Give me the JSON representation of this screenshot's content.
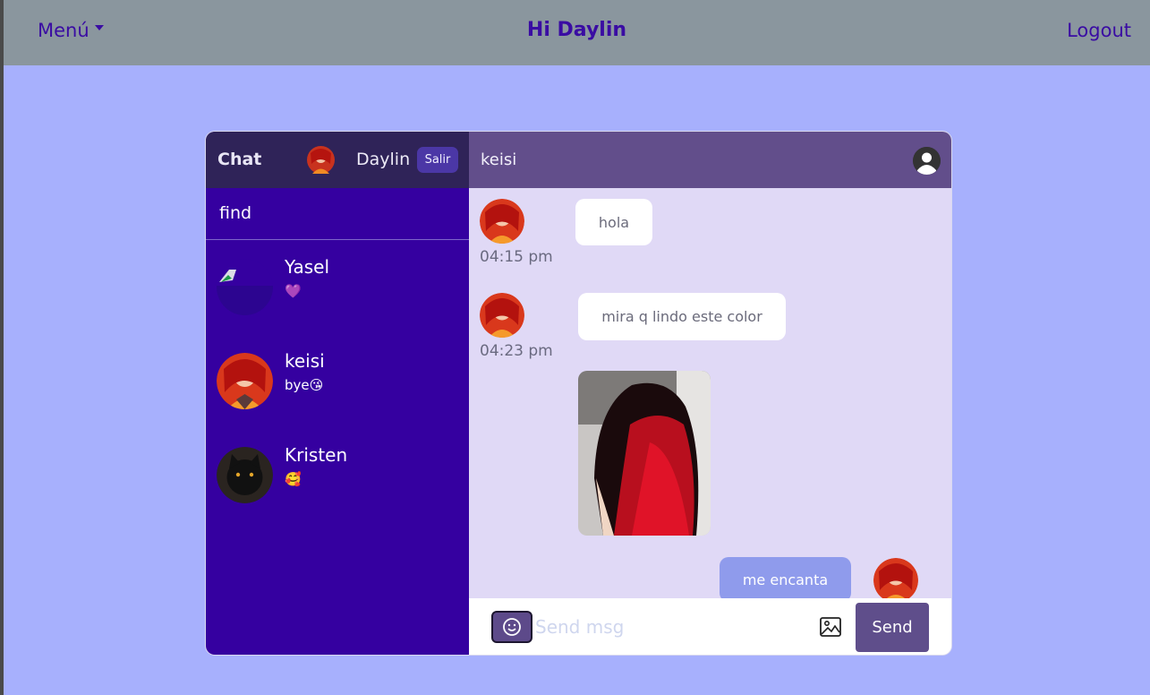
{
  "nav": {
    "menu_label": "Menú",
    "greeting": "Hi Daylin",
    "logout_label": "Logout"
  },
  "sidebar": {
    "brand": "Chat",
    "me_name": "Daylin",
    "salir_label": "Salir",
    "find_placeholder": "find",
    "contacts": [
      {
        "name": "Yasel",
        "last": "💜"
      },
      {
        "name": "keisi",
        "last": "bye😘"
      },
      {
        "name": "Kristen",
        "last": "🥰"
      }
    ]
  },
  "conversation": {
    "title": "keisi",
    "messages": [
      {
        "text": "hola",
        "time": "04:15 pm"
      },
      {
        "text": "mira q lindo este color",
        "time": "04:23 pm"
      },
      {
        "text": "me encanta",
        "mine": true
      }
    ]
  },
  "composer": {
    "placeholder": "Send msg",
    "send_label": "Send"
  }
}
